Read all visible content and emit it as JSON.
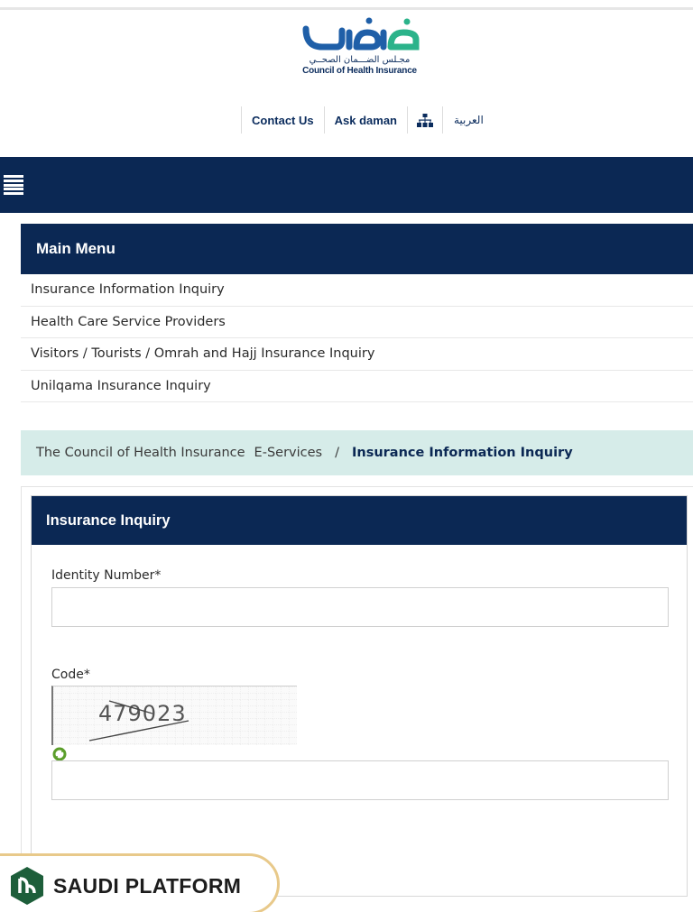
{
  "brand": {
    "logo_arabic": "ضمان",
    "subtitle_arabic": "مجـلس الضـــمان الصحــي",
    "subtitle_english": "Council of Health Insurance"
  },
  "toplinks": {
    "contact_us": "Contact Us",
    "ask_daman": "Ask daman",
    "arabic": "العربية"
  },
  "main_menu": {
    "title": "Main Menu",
    "items": [
      "Insurance Information Inquiry",
      "Health Care Service Providers",
      "Visitors / Tourists / Omrah and Hajj Insurance Inquiry",
      "Unilqama Insurance Inquiry"
    ]
  },
  "breadcrumb": {
    "home": "The Council of Health Insurance",
    "section": "E-Services",
    "separator": "/",
    "current": "Insurance Information Inquiry"
  },
  "form": {
    "title": "Insurance Inquiry",
    "identity_label": "Identity Number*",
    "identity_value": "",
    "code_label": "Code*",
    "code_value": "",
    "captcha_text": "479023"
  },
  "watermark": {
    "text": "SAUDI PLATFORM"
  },
  "colors": {
    "navy": "#0b2854",
    "brand_teal": "#2bb38a",
    "brand_blue": "#1f5fa8",
    "breadcrumb_bg": "#d6ece9"
  }
}
